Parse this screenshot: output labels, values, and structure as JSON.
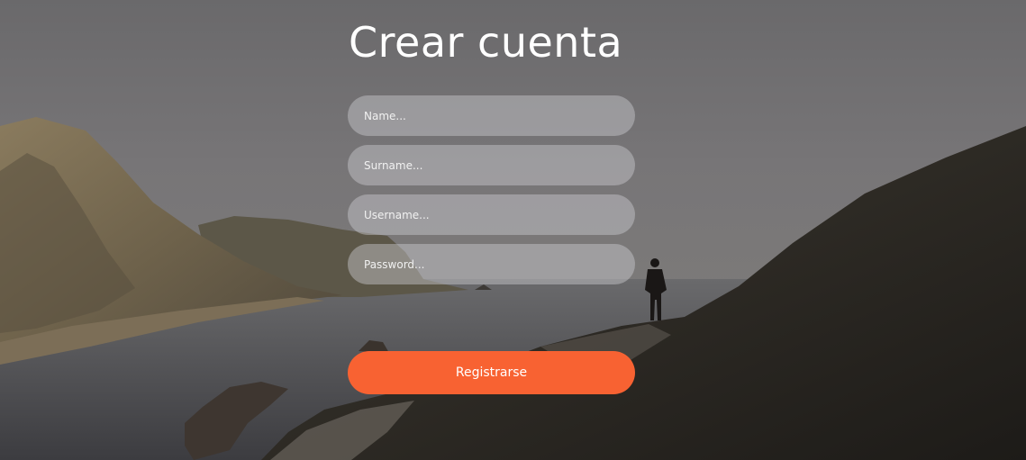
{
  "form": {
    "title": "Crear cuenta",
    "fields": [
      {
        "placeholder": "Name..."
      },
      {
        "placeholder": "Surname..."
      },
      {
        "placeholder": "Username..."
      },
      {
        "placeholder": "Password..."
      }
    ],
    "submit_label": "Registrarse"
  },
  "colors": {
    "accent": "#f86232",
    "field_background": "rgba(205,205,208,0.45)",
    "text": "#ffffff"
  }
}
